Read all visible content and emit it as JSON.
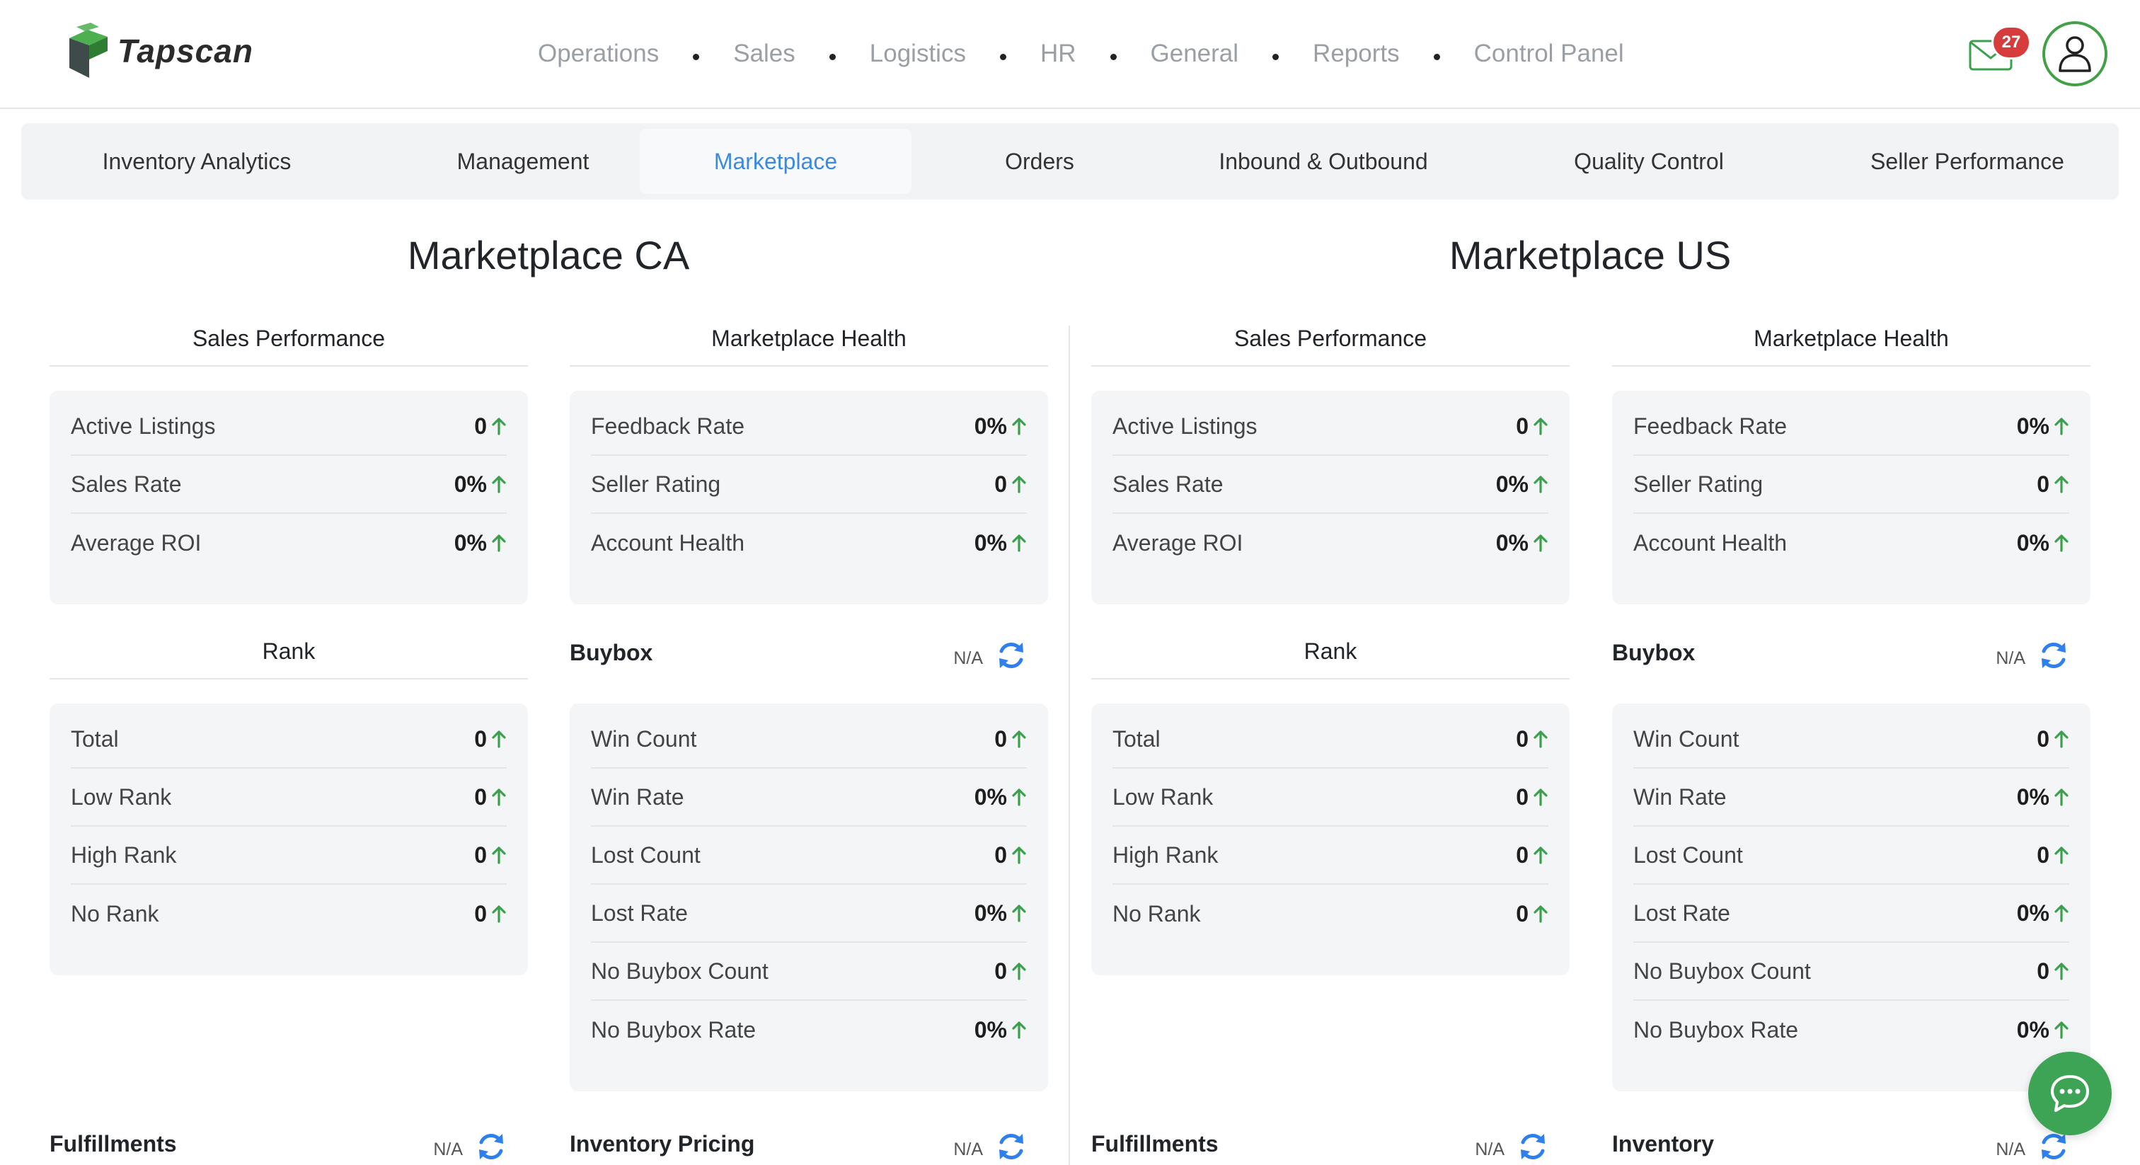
{
  "app": {
    "logo_text": "Tapscan"
  },
  "nav": {
    "items": [
      "Operations",
      "Sales",
      "Logistics",
      "HR",
      "General",
      "Reports",
      "Control Panel"
    ]
  },
  "header": {
    "mail_count": "27"
  },
  "subtabs": [
    {
      "label": "Inventory Analytics",
      "active": false
    },
    {
      "label": "Management",
      "active": false
    },
    {
      "label": "Marketplace",
      "active": true
    },
    {
      "label": "Orders",
      "active": false
    },
    {
      "label": "Inbound & Outbound",
      "active": false
    },
    {
      "label": "Quality Control",
      "active": false
    },
    {
      "label": "Seller Performance",
      "active": false
    }
  ],
  "colors": {
    "accent": "#3b8ae0",
    "positive": "#3aa04b",
    "brand": "#43a047",
    "badge": "#d63c3c"
  },
  "marketplaces": [
    {
      "title": "Marketplace CA",
      "sales_performance": {
        "title": "Sales Performance",
        "rows": [
          {
            "label": "Active Listings",
            "value": "0"
          },
          {
            "label": "Sales Rate",
            "value": "0%"
          },
          {
            "label": "Average ROI",
            "value": "0%"
          }
        ]
      },
      "marketplace_health": {
        "title": "Marketplace Health",
        "rows": [
          {
            "label": "Feedback Rate",
            "value": "0%"
          },
          {
            "label": "Seller Rating",
            "value": "0"
          },
          {
            "label": "Account Health",
            "value": "0%"
          }
        ]
      },
      "rank": {
        "title": "Rank",
        "rows": [
          {
            "label": "Total",
            "value": "0"
          },
          {
            "label": "Low Rank",
            "value": "0"
          },
          {
            "label": "High Rank",
            "value": "0"
          },
          {
            "label": "No Rank",
            "value": "0"
          }
        ]
      },
      "buybox": {
        "title": "Buybox",
        "status": "N/A",
        "rows": [
          {
            "label": "Win Count",
            "value": "0"
          },
          {
            "label": "Win Rate",
            "value": "0%"
          },
          {
            "label": "Lost Count",
            "value": "0"
          },
          {
            "label": "Lost Rate",
            "value": "0%"
          },
          {
            "label": "No Buybox Count",
            "value": "0"
          },
          {
            "label": "No Buybox Rate",
            "value": "0%"
          }
        ]
      },
      "bottom_left": {
        "title": "Fulfillments",
        "status": "N/A"
      },
      "bottom_right": {
        "title": "Inventory Pricing",
        "status": "N/A"
      }
    },
    {
      "title": "Marketplace US",
      "sales_performance": {
        "title": "Sales Performance",
        "rows": [
          {
            "label": "Active Listings",
            "value": "0"
          },
          {
            "label": "Sales Rate",
            "value": "0%"
          },
          {
            "label": "Average ROI",
            "value": "0%"
          }
        ]
      },
      "marketplace_health": {
        "title": "Marketplace Health",
        "rows": [
          {
            "label": "Feedback Rate",
            "value": "0%"
          },
          {
            "label": "Seller Rating",
            "value": "0"
          },
          {
            "label": "Account Health",
            "value": "0%"
          }
        ]
      },
      "rank": {
        "title": "Rank",
        "rows": [
          {
            "label": "Total",
            "value": "0"
          },
          {
            "label": "Low Rank",
            "value": "0"
          },
          {
            "label": "High Rank",
            "value": "0"
          },
          {
            "label": "No Rank",
            "value": "0"
          }
        ]
      },
      "buybox": {
        "title": "Buybox",
        "status": "N/A",
        "rows": [
          {
            "label": "Win Count",
            "value": "0"
          },
          {
            "label": "Win Rate",
            "value": "0%"
          },
          {
            "label": "Lost Count",
            "value": "0"
          },
          {
            "label": "Lost Rate",
            "value": "0%"
          },
          {
            "label": "No Buybox Count",
            "value": "0"
          },
          {
            "label": "No Buybox Rate",
            "value": "0%"
          }
        ]
      },
      "bottom_left": {
        "title": "Fulfillments",
        "status": "N/A"
      },
      "bottom_right": {
        "title": "Inventory",
        "status": "N/A"
      }
    }
  ],
  "icons": {
    "logo": "tapscan-cube-logo",
    "mail": "envelope-icon",
    "avatar": "user-icon",
    "trend": "arrow-up-icon",
    "refresh": "refresh-icon",
    "chat": "chat-bubble-icon"
  }
}
